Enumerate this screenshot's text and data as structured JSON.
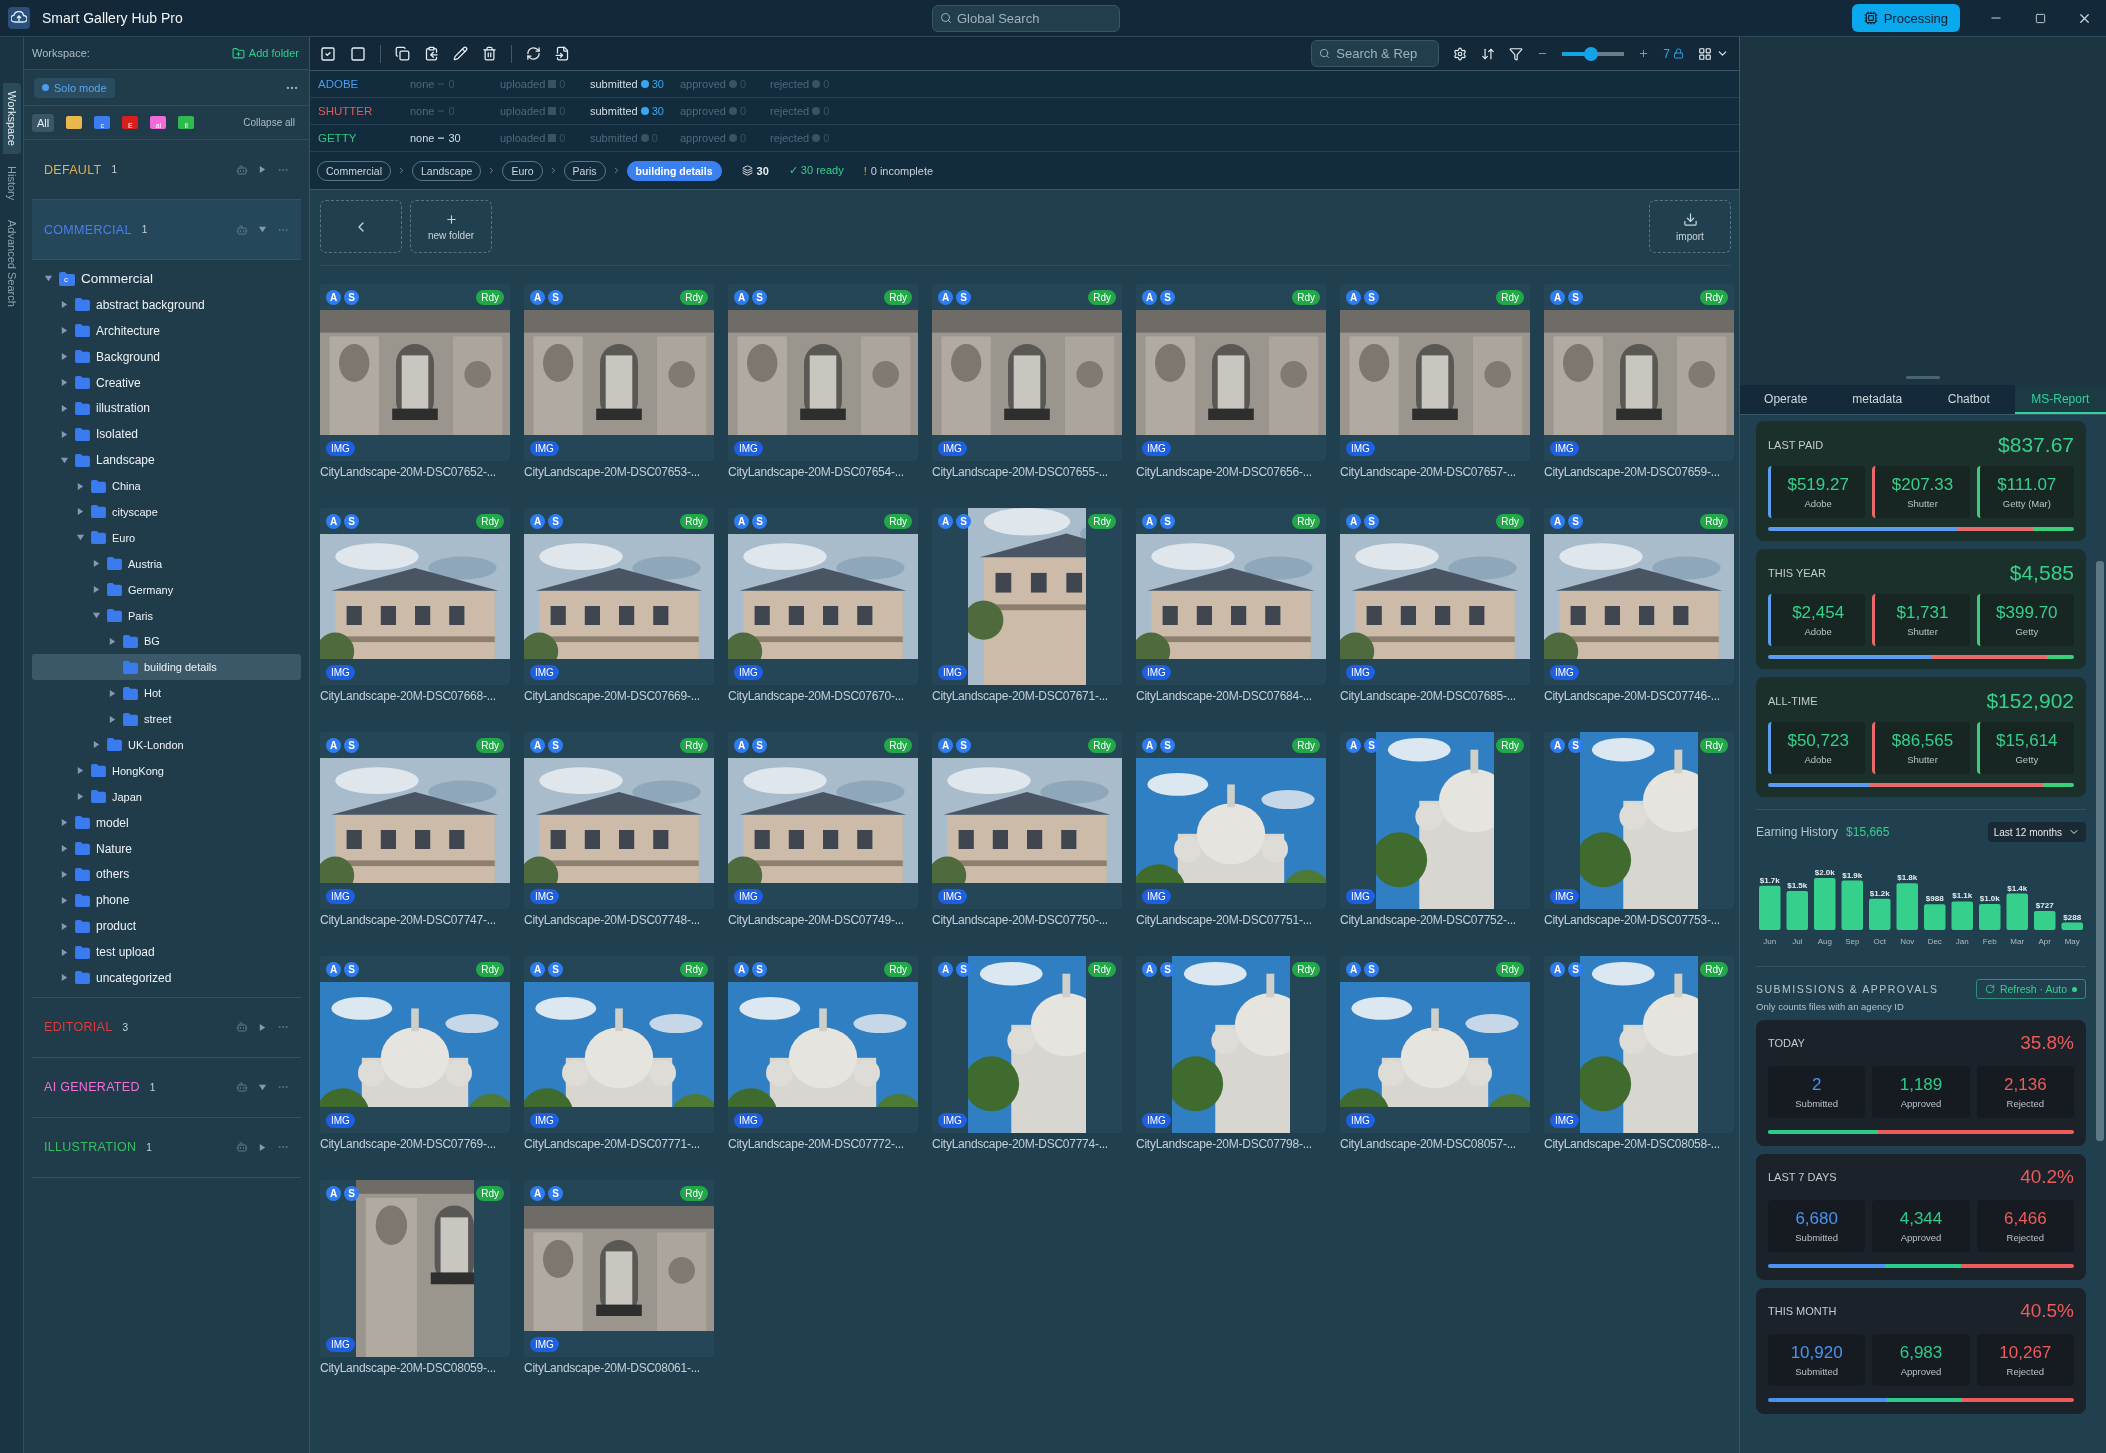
{
  "window": {
    "title": "Smart Gallery Hub Pro",
    "search_placeholder": "Global Search",
    "processing_button": "Processing"
  },
  "sidebar": {
    "vertical_tabs": [
      {
        "label": "Workspace",
        "selected": true
      },
      {
        "label": "History",
        "selected": false
      },
      {
        "label": "Advanced Search",
        "selected": false
      }
    ],
    "workspace_label": "Workspace:",
    "add_folder": "Add folder",
    "mode_chip": "Solo mode",
    "filters": [
      {
        "label": "All",
        "selected": true,
        "color": "#3a5566"
      },
      {
        "selected": false,
        "color": "#e8b84a"
      },
      {
        "label": "c",
        "selected": false,
        "color": "#3d7bf0"
      },
      {
        "label": "E",
        "selected": false,
        "color": "#d91e1e"
      },
      {
        "label": "ai",
        "selected": false,
        "color": "#f06ad8"
      },
      {
        "label": "ll",
        "selected": false,
        "color": "#2dbb4e"
      }
    ],
    "collapse_all": "Collapse all",
    "groups": [
      {
        "name": "DEFAULT",
        "count": "1",
        "color": "#e0b050",
        "expanded": false,
        "selected": false
      },
      {
        "name": "COMMERCIAL",
        "count": "1",
        "color": "#4a7ef0",
        "expanded": true,
        "selected": true,
        "tree": [
          {
            "label": "Commercial",
            "letter": "c",
            "expandable": true,
            "expanded": true,
            "selected": false,
            "children": [
              {
                "label": "abstract background",
                "expandable": true,
                "expanded": false,
                "selected": false
              },
              {
                "label": "Architecture",
                "expandable": true,
                "expanded": false,
                "selected": false
              },
              {
                "label": "Background",
                "expandable": true,
                "expanded": false,
                "selected": false
              },
              {
                "label": "Creative",
                "expandable": true,
                "expanded": false,
                "selected": false
              },
              {
                "label": "illustration",
                "expandable": true,
                "expanded": false,
                "selected": false
              },
              {
                "label": "Isolated",
                "expandable": true,
                "expanded": false,
                "selected": false
              },
              {
                "label": "Landscape",
                "expandable": true,
                "expanded": true,
                "selected": false,
                "children": [
                  {
                    "label": "China",
                    "expandable": true,
                    "expanded": false,
                    "selected": false
                  },
                  {
                    "label": "cityscape",
                    "expandable": true,
                    "expanded": false,
                    "selected": false
                  },
                  {
                    "label": "Euro",
                    "expandable": true,
                    "expanded": true,
                    "selected": false,
                    "children": [
                      {
                        "label": "Austria",
                        "expandable": true,
                        "expanded": false,
                        "selected": false
                      },
                      {
                        "label": "Germany",
                        "expandable": true,
                        "expanded": false,
                        "selected": false
                      },
                      {
                        "label": "Paris",
                        "expandable": true,
                        "expanded": true,
                        "selected": false,
                        "children": [
                          {
                            "label": "BG",
                            "expandable": true,
                            "expanded": false,
                            "selected": false
                          },
                          {
                            "label": "building details",
                            "expandable": false,
                            "expanded": false,
                            "selected": true
                          },
                          {
                            "label": "Hot",
                            "expandable": true,
                            "expanded": false,
                            "selected": false
                          },
                          {
                            "label": "street",
                            "expandable": true,
                            "expanded": false,
                            "selected": false
                          }
                        ]
                      },
                      {
                        "label": "UK-London",
                        "expandable": true,
                        "expanded": false,
                        "selected": false
                      }
                    ]
                  },
                  {
                    "label": "HongKong",
                    "expandable": true,
                    "expanded": false,
                    "selected": false
                  },
                  {
                    "label": "Japan",
                    "expandable": true,
                    "expanded": false,
                    "selected": false
                  }
                ]
              },
              {
                "label": "model",
                "expandable": true,
                "expanded": false,
                "selected": false
              },
              {
                "label": "Nature",
                "expandable": true,
                "expanded": false,
                "selected": false
              },
              {
                "label": "others",
                "expandable": true,
                "expanded": false,
                "selected": false
              },
              {
                "label": "phone",
                "expandable": true,
                "expanded": false,
                "selected": false
              },
              {
                "label": "product",
                "expandable": true,
                "expanded": false,
                "selected": false
              },
              {
                "label": "test upload",
                "expandable": true,
                "expanded": false,
                "selected": false
              },
              {
                "label": "uncategorized",
                "expandable": true,
                "expanded": false,
                "selected": false
              }
            ]
          }
        ]
      },
      {
        "name": "EDITORIAL",
        "count": "3",
        "color": "#e03a3a",
        "expanded": false,
        "selected": false
      },
      {
        "name": "AI GENERATED",
        "count": "1",
        "color": "#f070d8",
        "expanded": true,
        "selected": false
      },
      {
        "name": "ILLUSTRATION",
        "count": "1",
        "color": "#35c060",
        "expanded": false,
        "selected": false
      }
    ]
  },
  "toolbar": {
    "search_placeholder": "Search & Rep",
    "slider": {
      "level": 0.45
    },
    "columns": "7"
  },
  "agencies": [
    {
      "name": "ADOBE",
      "color": "#4a9df0",
      "statuses": [
        {
          "label": "none",
          "count": "0",
          "kind": "none",
          "active": false
        },
        {
          "label": "uploaded",
          "count": "0",
          "kind": "uploaded",
          "active": false
        },
        {
          "label": "submitted",
          "count": "30",
          "kind": "submitted",
          "active": true
        },
        {
          "label": "approved",
          "count": "0",
          "kind": "approved",
          "active": false
        },
        {
          "label": "rejected",
          "count": "0",
          "kind": "rejected",
          "active": false
        }
      ]
    },
    {
      "name": "SHUTTER",
      "color": "#e85a5a",
      "statuses": [
        {
          "label": "none",
          "count": "0",
          "kind": "none",
          "active": false
        },
        {
          "label": "uploaded",
          "count": "0",
          "kind": "uploaded",
          "active": false
        },
        {
          "label": "submitted",
          "count": "30",
          "kind": "submitted",
          "active": true
        },
        {
          "label": "approved",
          "count": "0",
          "kind": "approved",
          "active": false
        },
        {
          "label": "rejected",
          "count": "0",
          "kind": "rejected",
          "active": false
        }
      ]
    },
    {
      "name": "GETTY",
      "color": "#35c880",
      "statuses": [
        {
          "label": "none",
          "count": "30",
          "kind": "none",
          "active": true
        },
        {
          "label": "uploaded",
          "count": "0",
          "kind": "uploaded",
          "active": false
        },
        {
          "label": "submitted",
          "count": "0",
          "kind": "submitted",
          "active": false
        },
        {
          "label": "approved",
          "count": "0",
          "kind": "approved",
          "active": false
        },
        {
          "label": "rejected",
          "count": "0",
          "kind": "rejected",
          "active": false
        }
      ]
    }
  ],
  "breadcrumbs": [
    {
      "label": "Commercial",
      "selected": false
    },
    {
      "label": "Landscape",
      "selected": false
    },
    {
      "label": "Euro",
      "selected": false
    },
    {
      "label": "Paris",
      "selected": false
    },
    {
      "label": "building details",
      "selected": true
    }
  ],
  "summary": {
    "total": "30",
    "ready": {
      "mark": "✓",
      "text": "30 ready"
    },
    "incomplete": {
      "mark": "!",
      "text": "0 incomplete"
    }
  },
  "gallery": {
    "new_folder": "new folder",
    "import": "import",
    "items": [
      {
        "name": "CityLandscape-20M-DSC07652-...",
        "badges": [
          "A",
          "S"
        ],
        "status": "Rdy",
        "type": "IMG",
        "portrait": false
      },
      {
        "name": "CityLandscape-20M-DSC07653-...",
        "badges": [
          "A",
          "S"
        ],
        "status": "Rdy",
        "type": "IMG",
        "portrait": false
      },
      {
        "name": "CityLandscape-20M-DSC07654-...",
        "badges": [
          "A",
          "S"
        ],
        "status": "Rdy",
        "type": "IMG",
        "portrait": false
      },
      {
        "name": "CityLandscape-20M-DSC07655-...",
        "badges": [
          "A",
          "S"
        ],
        "status": "Rdy",
        "type": "IMG",
        "portrait": false
      },
      {
        "name": "CityLandscape-20M-DSC07656-...",
        "badges": [
          "A",
          "S"
        ],
        "status": "Rdy",
        "type": "IMG",
        "portrait": false
      },
      {
        "name": "CityLandscape-20M-DSC07657-...",
        "badges": [
          "A",
          "S"
        ],
        "status": "Rdy",
        "type": "IMG",
        "portrait": false
      },
      {
        "name": "CityLandscape-20M-DSC07659-...",
        "badges": [
          "A",
          "S"
        ],
        "status": "Rdy",
        "type": "IMG",
        "portrait": false
      },
      {
        "name": "CityLandscape-20M-DSC07668-...",
        "badges": [
          "A",
          "S"
        ],
        "status": "Rdy",
        "type": "IMG",
        "portrait": false
      },
      {
        "name": "CityLandscape-20M-DSC07669-...",
        "badges": [
          "A",
          "S"
        ],
        "status": "Rdy",
        "type": "IMG",
        "portrait": false
      },
      {
        "name": "CityLandscape-20M-DSC07670-...",
        "badges": [
          "A",
          "S"
        ],
        "status": "Rdy",
        "type": "IMG",
        "portrait": false
      },
      {
        "name": "CityLandscape-20M-DSC07671-...",
        "badges": [
          "A",
          "S"
        ],
        "status": "Rdy",
        "type": "IMG",
        "portrait": true
      },
      {
        "name": "CityLandscape-20M-DSC07684-...",
        "badges": [
          "A",
          "S"
        ],
        "status": "Rdy",
        "type": "IMG",
        "portrait": false
      },
      {
        "name": "CityLandscape-20M-DSC07685-...",
        "badges": [
          "A",
          "S"
        ],
        "status": "Rdy",
        "type": "IMG",
        "portrait": false
      },
      {
        "name": "CityLandscape-20M-DSC07746-...",
        "badges": [
          "A",
          "S"
        ],
        "status": "Rdy",
        "type": "IMG",
        "portrait": false
      },
      {
        "name": "CityLandscape-20M-DSC07747-...",
        "badges": [
          "A",
          "S"
        ],
        "status": "Rdy",
        "type": "IMG",
        "portrait": false
      },
      {
        "name": "CityLandscape-20M-DSC07748-...",
        "badges": [
          "A",
          "S"
        ],
        "status": "Rdy",
        "type": "IMG",
        "portrait": false
      },
      {
        "name": "CityLandscape-20M-DSC07749-...",
        "badges": [
          "A",
          "S"
        ],
        "status": "Rdy",
        "type": "IMG",
        "portrait": false
      },
      {
        "name": "CityLandscape-20M-DSC07750-...",
        "badges": [
          "A",
          "S"
        ],
        "status": "Rdy",
        "type": "IMG",
        "portrait": false
      },
      {
        "name": "CityLandscape-20M-DSC07751-...",
        "badges": [
          "A",
          "S"
        ],
        "status": "Rdy",
        "type": "IMG",
        "portrait": false
      },
      {
        "name": "CityLandscape-20M-DSC07752-...",
        "badges": [
          "A",
          "S"
        ],
        "status": "Rdy",
        "type": "IMG",
        "portrait": true
      },
      {
        "name": "CityLandscape-20M-DSC07753-...",
        "badges": [
          "A",
          "S"
        ],
        "status": "Rdy",
        "type": "IMG",
        "portrait": true
      },
      {
        "name": "CityLandscape-20M-DSC07769-...",
        "badges": [
          "A",
          "S"
        ],
        "status": "Rdy",
        "type": "IMG",
        "portrait": false
      },
      {
        "name": "CityLandscape-20M-DSC07771-...",
        "badges": [
          "A",
          "S"
        ],
        "status": "Rdy",
        "type": "IMG",
        "portrait": false
      },
      {
        "name": "CityLandscape-20M-DSC07772-...",
        "badges": [
          "A",
          "S"
        ],
        "status": "Rdy",
        "type": "IMG",
        "portrait": false
      },
      {
        "name": "CityLandscape-20M-DSC07774-...",
        "badges": [
          "A",
          "S"
        ],
        "status": "Rdy",
        "type": "IMG",
        "portrait": true
      },
      {
        "name": "CityLandscape-20M-DSC07798-...",
        "badges": [
          "A",
          "S"
        ],
        "status": "Rdy",
        "type": "IMG",
        "portrait": true
      },
      {
        "name": "CityLandscape-20M-DSC08057-...",
        "badges": [
          "A",
          "S"
        ],
        "status": "Rdy",
        "type": "IMG",
        "portrait": false
      },
      {
        "name": "CityLandscape-20M-DSC08058-...",
        "badges": [
          "A",
          "S"
        ],
        "status": "Rdy",
        "type": "IMG",
        "portrait": true
      },
      {
        "name": "CityLandscape-20M-DSC08059-...",
        "badges": [
          "A",
          "S"
        ],
        "status": "Rdy",
        "type": "IMG",
        "portrait": true
      },
      {
        "name": "CityLandscape-20M-DSC08061-...",
        "badges": [
          "A",
          "S"
        ],
        "status": "Rdy",
        "type": "IMG",
        "portrait": false
      }
    ]
  },
  "right_panel": {
    "tabs": [
      {
        "label": "Operate",
        "selected": false
      },
      {
        "label": "metadata",
        "selected": false
      },
      {
        "label": "Chatbot",
        "selected": false
      },
      {
        "label": "MS-Report",
        "selected": true
      }
    ],
    "earnings": [
      {
        "label": "LAST PAID",
        "total": "$837.67",
        "parts": [
          {
            "value": "$519.27",
            "label": "Adobe",
            "color": "#5b9cf0"
          },
          {
            "value": "$207.33",
            "label": "Shutter",
            "color": "#e86a6a"
          },
          {
            "value": "$111.07",
            "label": "Getty (Mar)",
            "color": "#3ccf7a"
          }
        ]
      },
      {
        "label": "THIS YEAR",
        "total": "$4,585",
        "parts": [
          {
            "value": "$2,454",
            "label": "Adobe",
            "color": "#5b9cf0"
          },
          {
            "value": "$1,731",
            "label": "Shutter",
            "color": "#e86a6a"
          },
          {
            "value": "$399.70",
            "label": "Getty",
            "color": "#3ccf7a"
          }
        ]
      },
      {
        "label": "ALL-TIME",
        "total": "$152,902",
        "parts": [
          {
            "value": "$50,723",
            "label": "Adobe",
            "color": "#5b9cf0"
          },
          {
            "value": "$86,565",
            "label": "Shutter",
            "color": "#e86a6a"
          },
          {
            "value": "$15,614",
            "label": "Getty",
            "color": "#3ccf7a"
          }
        ]
      }
    ],
    "history": {
      "total": "$15,665",
      "range": "Last 12 months",
      "chart_data": {
        "type": "bar",
        "title": "Earning History",
        "categories": [
          "Jun",
          "Jul",
          "Aug",
          "Sep",
          "Oct",
          "Nov",
          "Dec",
          "Jan",
          "Feb",
          "Mar",
          "Apr",
          "May"
        ],
        "values": [
          1700,
          1500,
          2000,
          1900,
          1200,
          1800,
          988,
          1100,
          1000,
          1400,
          727,
          288
        ],
        "data_labels": true,
        "value_labels": [
          "$1.7k",
          "$1.5k",
          "$2.0k",
          "$1.9k",
          "$1.2k",
          "$1.8k",
          "$988",
          "$1.1k",
          "$1.0k",
          "$1.4k",
          "$727",
          "$288"
        ]
      }
    },
    "submissions": {
      "title": "SUBMISSIONS & APPROVALS",
      "refresh": "Refresh · Auto",
      "note": "Only counts files with an agency ID",
      "cards": [
        {
          "label": "TODAY",
          "rate": "35.8%",
          "stats": [
            {
              "value": "2",
              "label": "Submitted",
              "kind": "submitted"
            },
            {
              "value": "1,189",
              "label": "Approved",
              "kind": "approved"
            },
            {
              "value": "2,136",
              "label": "Rejected",
              "kind": "rejected"
            }
          ]
        },
        {
          "label": "LAST 7 DAYS",
          "rate": "40.2%",
          "stats": [
            {
              "value": "6,680",
              "label": "Submitted",
              "kind": "submitted"
            },
            {
              "value": "4,344",
              "label": "Approved",
              "kind": "approved"
            },
            {
              "value": "6,466",
              "label": "Rejected",
              "kind": "rejected"
            }
          ]
        },
        {
          "label": "THIS MONTH",
          "rate": "40.5%",
          "stats": [
            {
              "value": "10,920",
              "label": "Submitted",
              "kind": "submitted"
            },
            {
              "value": "6,983",
              "label": "Approved",
              "kind": "approved"
            },
            {
              "value": "10,267",
              "label": "Rejected",
              "kind": "rejected"
            }
          ]
        }
      ]
    }
  }
}
